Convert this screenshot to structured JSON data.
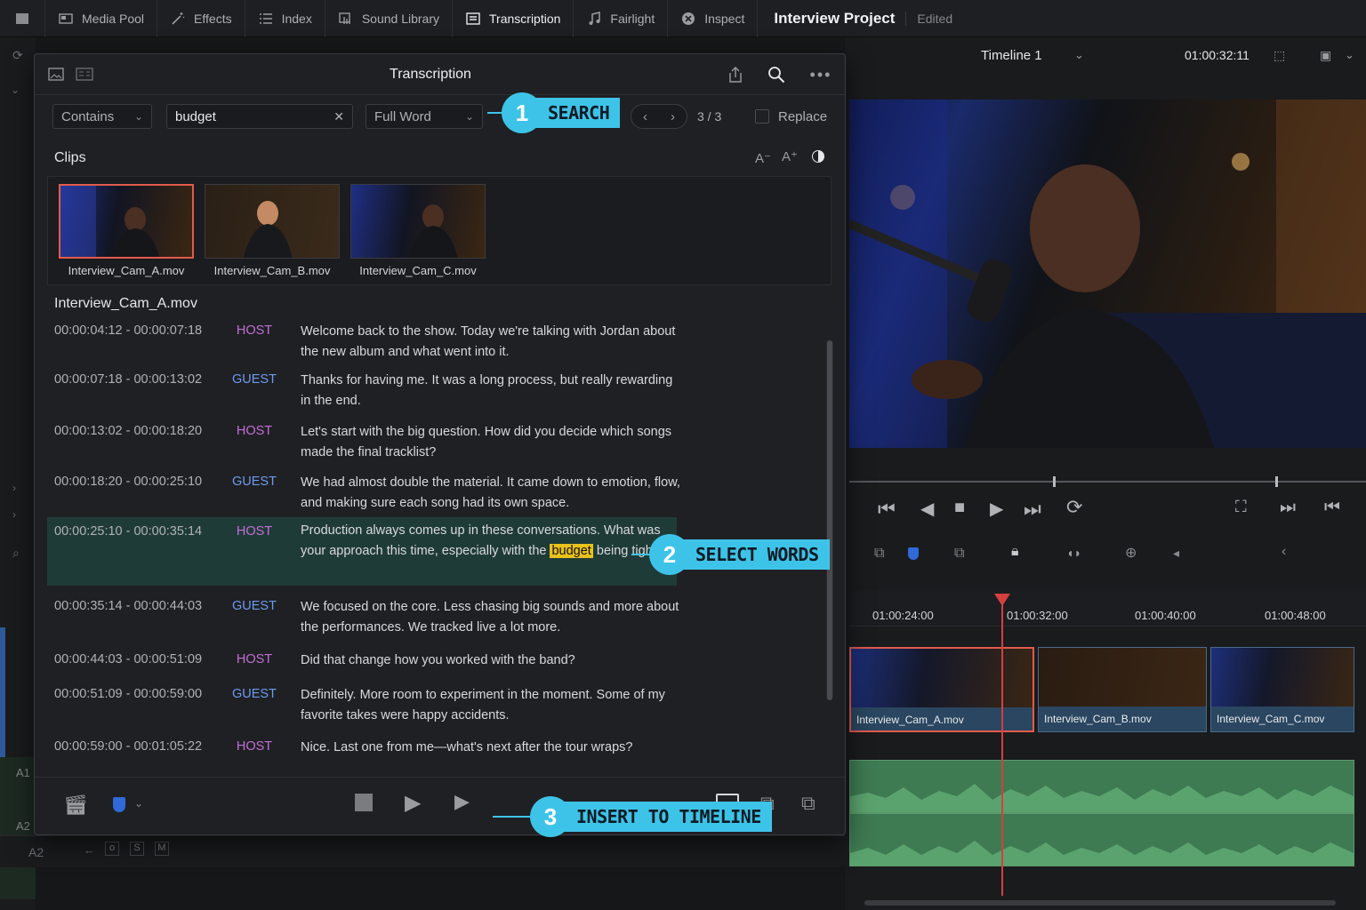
{
  "topbar": {
    "tabs": [
      {
        "label": "Media Pool",
        "icon": "media-pool-icon"
      },
      {
        "label": "Effects",
        "icon": "effects-wand-icon"
      },
      {
        "label": "Index",
        "icon": "index-list-icon"
      },
      {
        "label": "Sound Library",
        "icon": "sound-library-icon"
      },
      {
        "label": "Transcription",
        "icon": "transcription-icon",
        "active": true
      },
      {
        "label": "Fairlight",
        "icon": "music-note-icon"
      },
      {
        "label": "Inspect",
        "icon": "inspect-icon"
      }
    ],
    "project": "Interview Project",
    "status": "Edited"
  },
  "viewer": {
    "timeline_name": "Timeline 1",
    "timecode": "01:00:32:11"
  },
  "timeline": {
    "ruler": [
      "01:00:24:00",
      "01:00:32:00",
      "01:00:40:00",
      "01:00:48:00"
    ],
    "clips": [
      "Interview_Cam_A.mov",
      "Interview_Cam_B.mov",
      "Interview_Cam_C.mov"
    ],
    "tracks": [
      "A1",
      "A2",
      "A2"
    ],
    "track_buttons": [
      "S",
      "M"
    ]
  },
  "panel": {
    "title": "Transcription",
    "search": {
      "mode": "Contains",
      "query": "budget",
      "match": "Full Word",
      "count": "3 / 3",
      "replace_label": "Replace"
    },
    "clips_label": "Clips",
    "clips": [
      "Interview_Cam_A.mov",
      "Interview_Cam_B.mov",
      "Interview_Cam_C.mov"
    ],
    "transcript_title": "Interview_Cam_A.mov",
    "rows": [
      {
        "time": "00:00:04:12 - 00:00:07:18",
        "speaker": "HOST",
        "text": "Welcome back to the show. Today we're talking with Jordan about the new album and what went into it."
      },
      {
        "time": "00:00:07:18 - 00:00:13:02",
        "speaker": "GUEST",
        "text": "Thanks for having me. It was a long process, but really rewarding in the end."
      },
      {
        "time": "00:00:13:02 - 00:00:18:20",
        "speaker": "HOST",
        "text": "Let's start with the big question. How did you decide which songs made the final tracklist?"
      },
      {
        "time": "00:00:18:20 - 00:00:25:10",
        "speaker": "GUEST",
        "text": "We had almost double the material. It came down to emotion, flow, and making sure each song had its own space."
      },
      {
        "time": "00:00:25:10 - 00:00:35:14",
        "speaker": "HOST",
        "text_before": "Production always comes up in these conversations. What was your approach this time, especially with the",
        "highlight": "budget",
        "text_after": "being tighter?"
      },
      {
        "time": "00:00:35:14 - 00:00:44:03",
        "speaker": "GUEST",
        "text": "We focused on the core. Less chasing big sounds and more about the performances. We tracked live a lot more."
      },
      {
        "time": "00:00:44:03 - 00:00:51:09",
        "speaker": "HOST",
        "text": "Did that change how you worked with the band?"
      },
      {
        "time": "00:00:51:09 - 00:00:59:00",
        "speaker": "GUEST",
        "text": "Definitely. More room to experiment in the moment. Some of my favorite takes were happy accidents."
      },
      {
        "time": "00:00:59:00 - 00:01:05:22",
        "speaker": "HOST",
        "text": "Nice. Last one from me—what's next after the tour wraps?"
      }
    ]
  },
  "callouts": [
    {
      "num": "1",
      "label": "SEARCH"
    },
    {
      "num": "2",
      "label": "SELECT WORDS"
    },
    {
      "num": "3",
      "label": "INSERT TO TIMELINE"
    }
  ],
  "colors": {
    "accent": "#3ec3e8",
    "host": "#c26fd6",
    "guest": "#6d9bf0",
    "highlight": "#e8c11b",
    "selected_clip": "#e25b4c"
  }
}
